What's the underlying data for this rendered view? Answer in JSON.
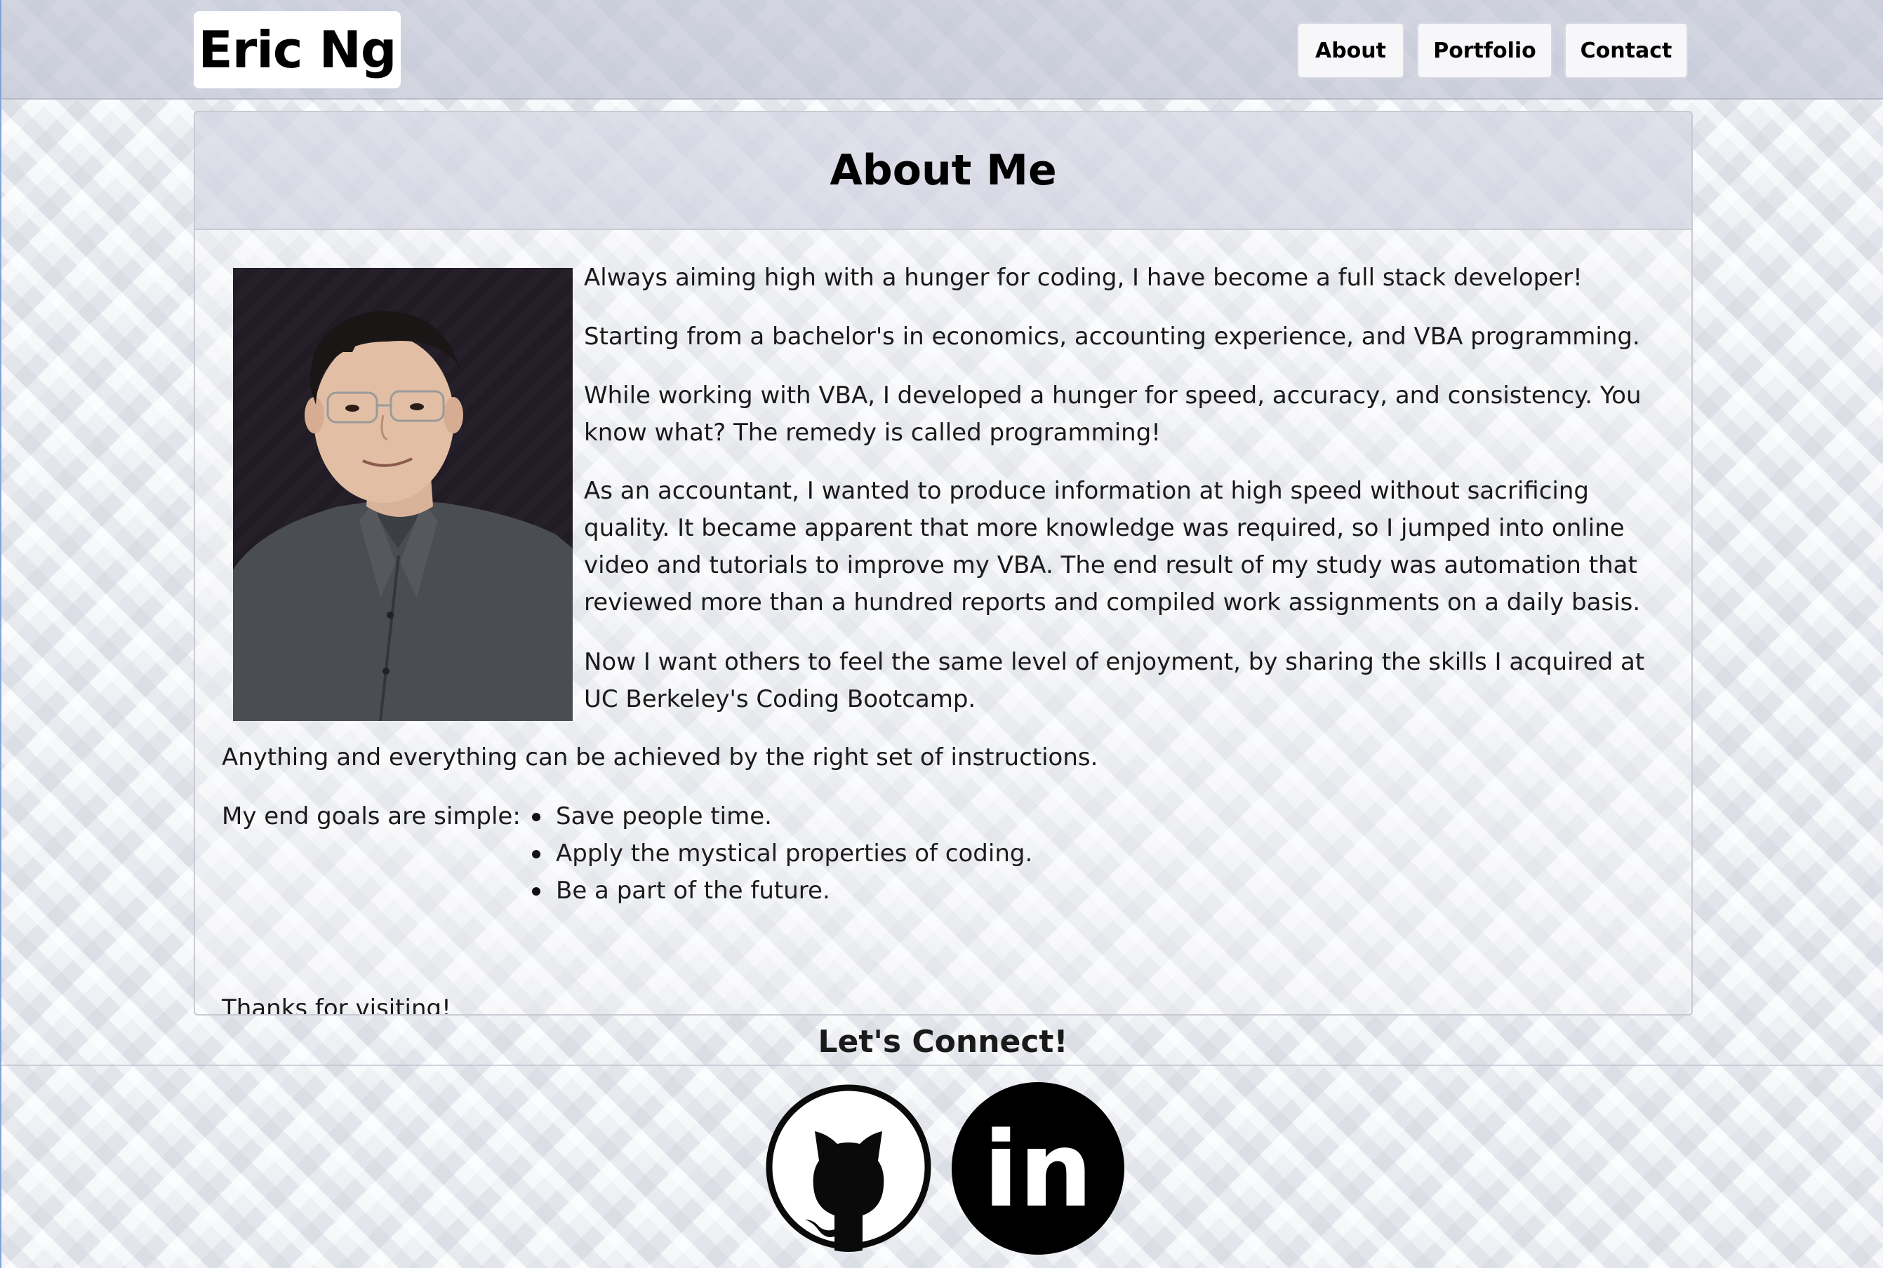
{
  "header": {
    "brand": "Eric Ng",
    "nav": [
      "About",
      "Portfolio",
      "Contact"
    ]
  },
  "about": {
    "title": "About Me",
    "photo_alt": "Portrait of Eric Ng",
    "paragraphs": [
      "Always aiming high with a hunger for coding, I have become a full stack developer!",
      "Starting from a bachelor's in economics, accounting experience, and VBA programming.",
      "While working with VBA, I developed a hunger for speed, accuracy, and consistency. You know what? The remedy is called programming!",
      "As an accountant, I wanted to produce information at high speed without sacrificing quality. It became apparent that more knowledge was required, so I jumped into online video and tutorials to improve my VBA. The end result of my study was automation that reviewed more than a hundred reports and compiled work assignments on a daily basis.",
      "Now I want others to feel the same level of enjoyment, by sharing the skills I acquired at UC Berkeley's Coding Bootcamp.",
      "Anything and everything can be achieved by the right set of instructions."
    ],
    "goals_label": "My end goals are simple:",
    "goals": [
      "Save people time.",
      "Apply the mystical properties of coding.",
      "Be a part of the future."
    ],
    "closing": "Thanks for visiting!"
  },
  "footer": {
    "connect_title": "Let's Connect!",
    "links": [
      {
        "name": "github",
        "icon": "github-icon"
      },
      {
        "name": "linkedin",
        "icon": "linkedin-icon",
        "text": "in"
      }
    ]
  }
}
